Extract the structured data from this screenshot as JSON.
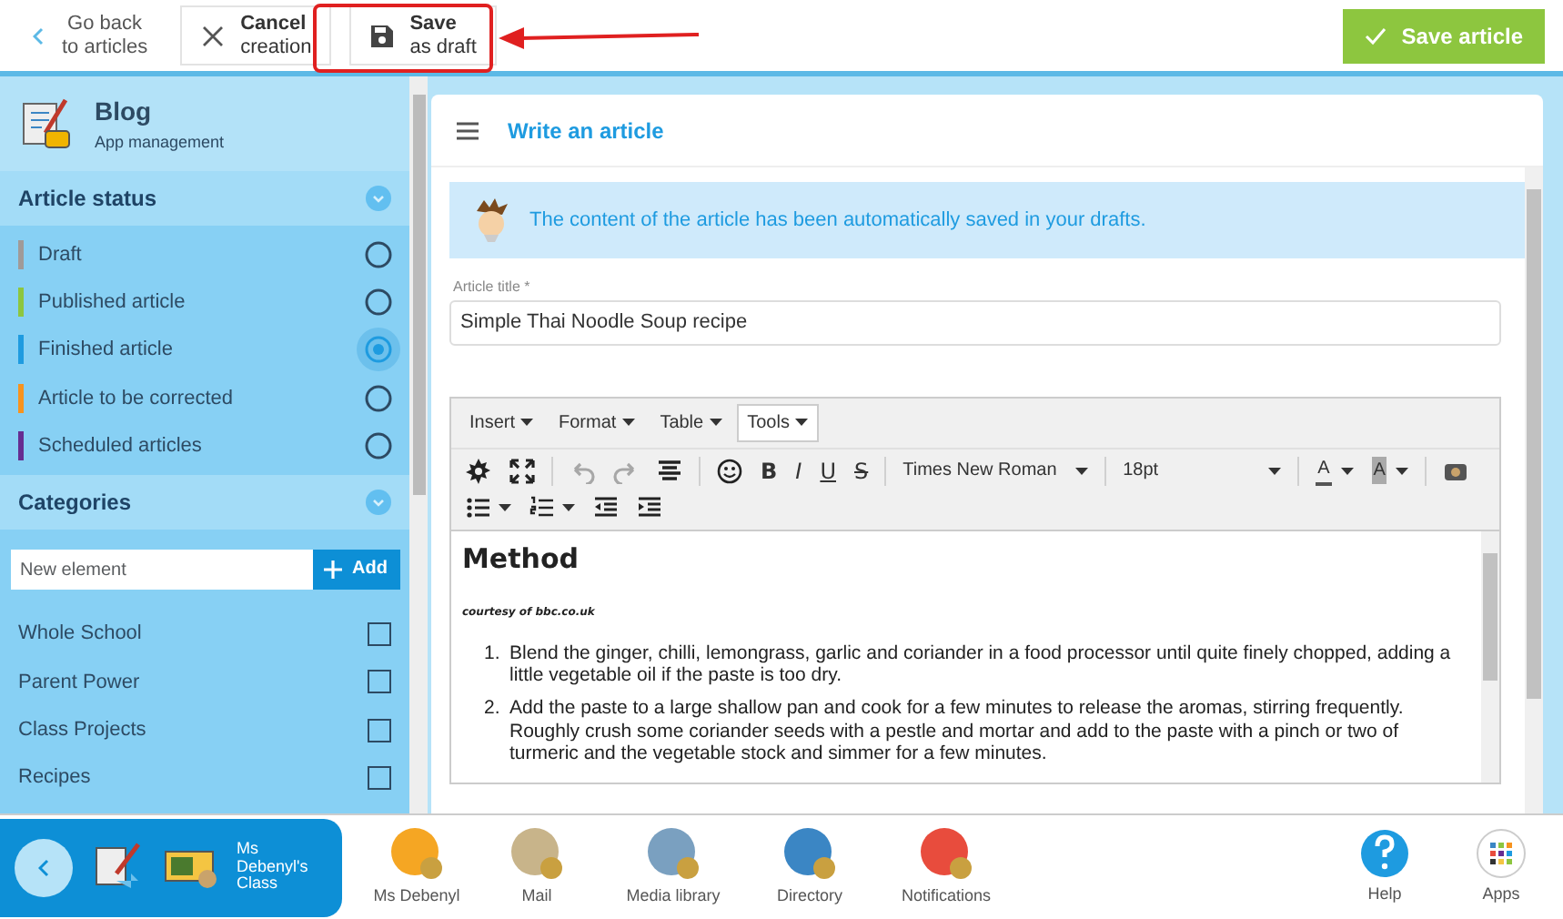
{
  "topbar": {
    "back": {
      "title": "Go back",
      "subtitle": "to articles"
    },
    "buttons": [
      {
        "title": "Cancel",
        "subtitle": "creation"
      },
      {
        "title": "Save",
        "subtitle": "as draft"
      }
    ],
    "primary": "Save article"
  },
  "sidebar": {
    "app": {
      "title": "Blog",
      "subtitle": "App management"
    },
    "status": {
      "title": "Article status",
      "items": [
        {
          "label": "Draft",
          "color": "#a09a98",
          "selected": false
        },
        {
          "label": "Published article",
          "color": "#8dc63f",
          "selected": false
        },
        {
          "label": "Finished article",
          "color": "#1e9be0",
          "selected": true
        },
        {
          "label": "Article to be corrected",
          "color": "#f7931e",
          "selected": false
        },
        {
          "label": "Scheduled articles",
          "color": "#662d91",
          "selected": false
        }
      ]
    },
    "categories": {
      "title": "Categories",
      "placeholder": "New element",
      "add": "Add",
      "items": [
        {
          "label": "Whole School",
          "checked": false
        },
        {
          "label": "Parent Power",
          "checked": false
        },
        {
          "label": "Class Projects",
          "checked": false
        },
        {
          "label": "Recipes",
          "checked": false
        }
      ]
    }
  },
  "main": {
    "title": "Write an article",
    "notice": "The content of the article has been automatically saved in your drafts.",
    "field": {
      "label": "Article title *",
      "value": "Simple Thai Noodle Soup recipe"
    },
    "editor": {
      "menus": [
        {
          "label": "Insert",
          "selected": false
        },
        {
          "label": "Format",
          "selected": false
        },
        {
          "label": "Table",
          "selected": false
        },
        {
          "label": "Tools",
          "selected": true
        }
      ],
      "toolbar": [
        [
          {
            "kind": "icon",
            "disabled": false
          },
          {
            "kind": "icon",
            "disabled": false
          },
          {
            "kind": "sep"
          },
          {
            "kind": "icon",
            "disabled": true
          },
          {
            "kind": "icon",
            "disabled": true
          },
          {
            "kind": "icon",
            "disabled": false
          },
          {
            "kind": "sep"
          },
          {
            "kind": "icon",
            "disabled": false
          },
          {
            "kind": "text",
            "label": "B",
            "disabled": false
          },
          {
            "kind": "text",
            "label": "I",
            "disabled": false
          },
          {
            "kind": "text",
            "label": "U",
            "disabled": false
          },
          {
            "kind": "text",
            "label": "S",
            "disabled": false
          },
          {
            "kind": "sep"
          },
          {
            "kind": "select",
            "label": "Times New Roman",
            "disabled": false
          },
          {
            "kind": "sep"
          },
          {
            "kind": "select",
            "label": "18pt",
            "disabled": false
          },
          {
            "kind": "sep"
          },
          {
            "kind": "color",
            "label": "A",
            "disabled": false
          },
          {
            "kind": "color",
            "label": "A",
            "disabled": false
          },
          {
            "kind": "sep"
          },
          {
            "kind": "icon",
            "disabled": false
          }
        ],
        [
          {
            "kind": "iconmenu",
            "disabled": false
          },
          {
            "kind": "iconmenu",
            "disabled": false
          },
          {
            "kind": "icon",
            "disabled": false
          },
          {
            "kind": "icon",
            "disabled": false
          }
        ]
      ],
      "content": {
        "heading": "Method",
        "credit": "courtesy of bbc.co.uk",
        "steps": [
          {
            "marker": "1.",
            "text": "Blend the ginger, chilli, lemongrass, garlic and coriander in a food processor until quite finely chopped, adding a little vegetable oil if the paste is too dry."
          },
          {
            "marker": "2.",
            "text": "Add the paste to a large shallow pan and cook for a few minutes to release the aromas, stirring frequently. Roughly crush some coriander seeds with a pestle and mortar and add to the paste with a pinch or two of turmeric and the vegetable stock and simmer for a few minutes."
          }
        ]
      }
    }
  },
  "dock": {
    "context": "Ms Debenyl's Class",
    "apps": [
      "Ms Debenyl",
      "Mail",
      "Media library",
      "Directory",
      "Notifications"
    ],
    "right": [
      "Help",
      "Apps"
    ]
  }
}
